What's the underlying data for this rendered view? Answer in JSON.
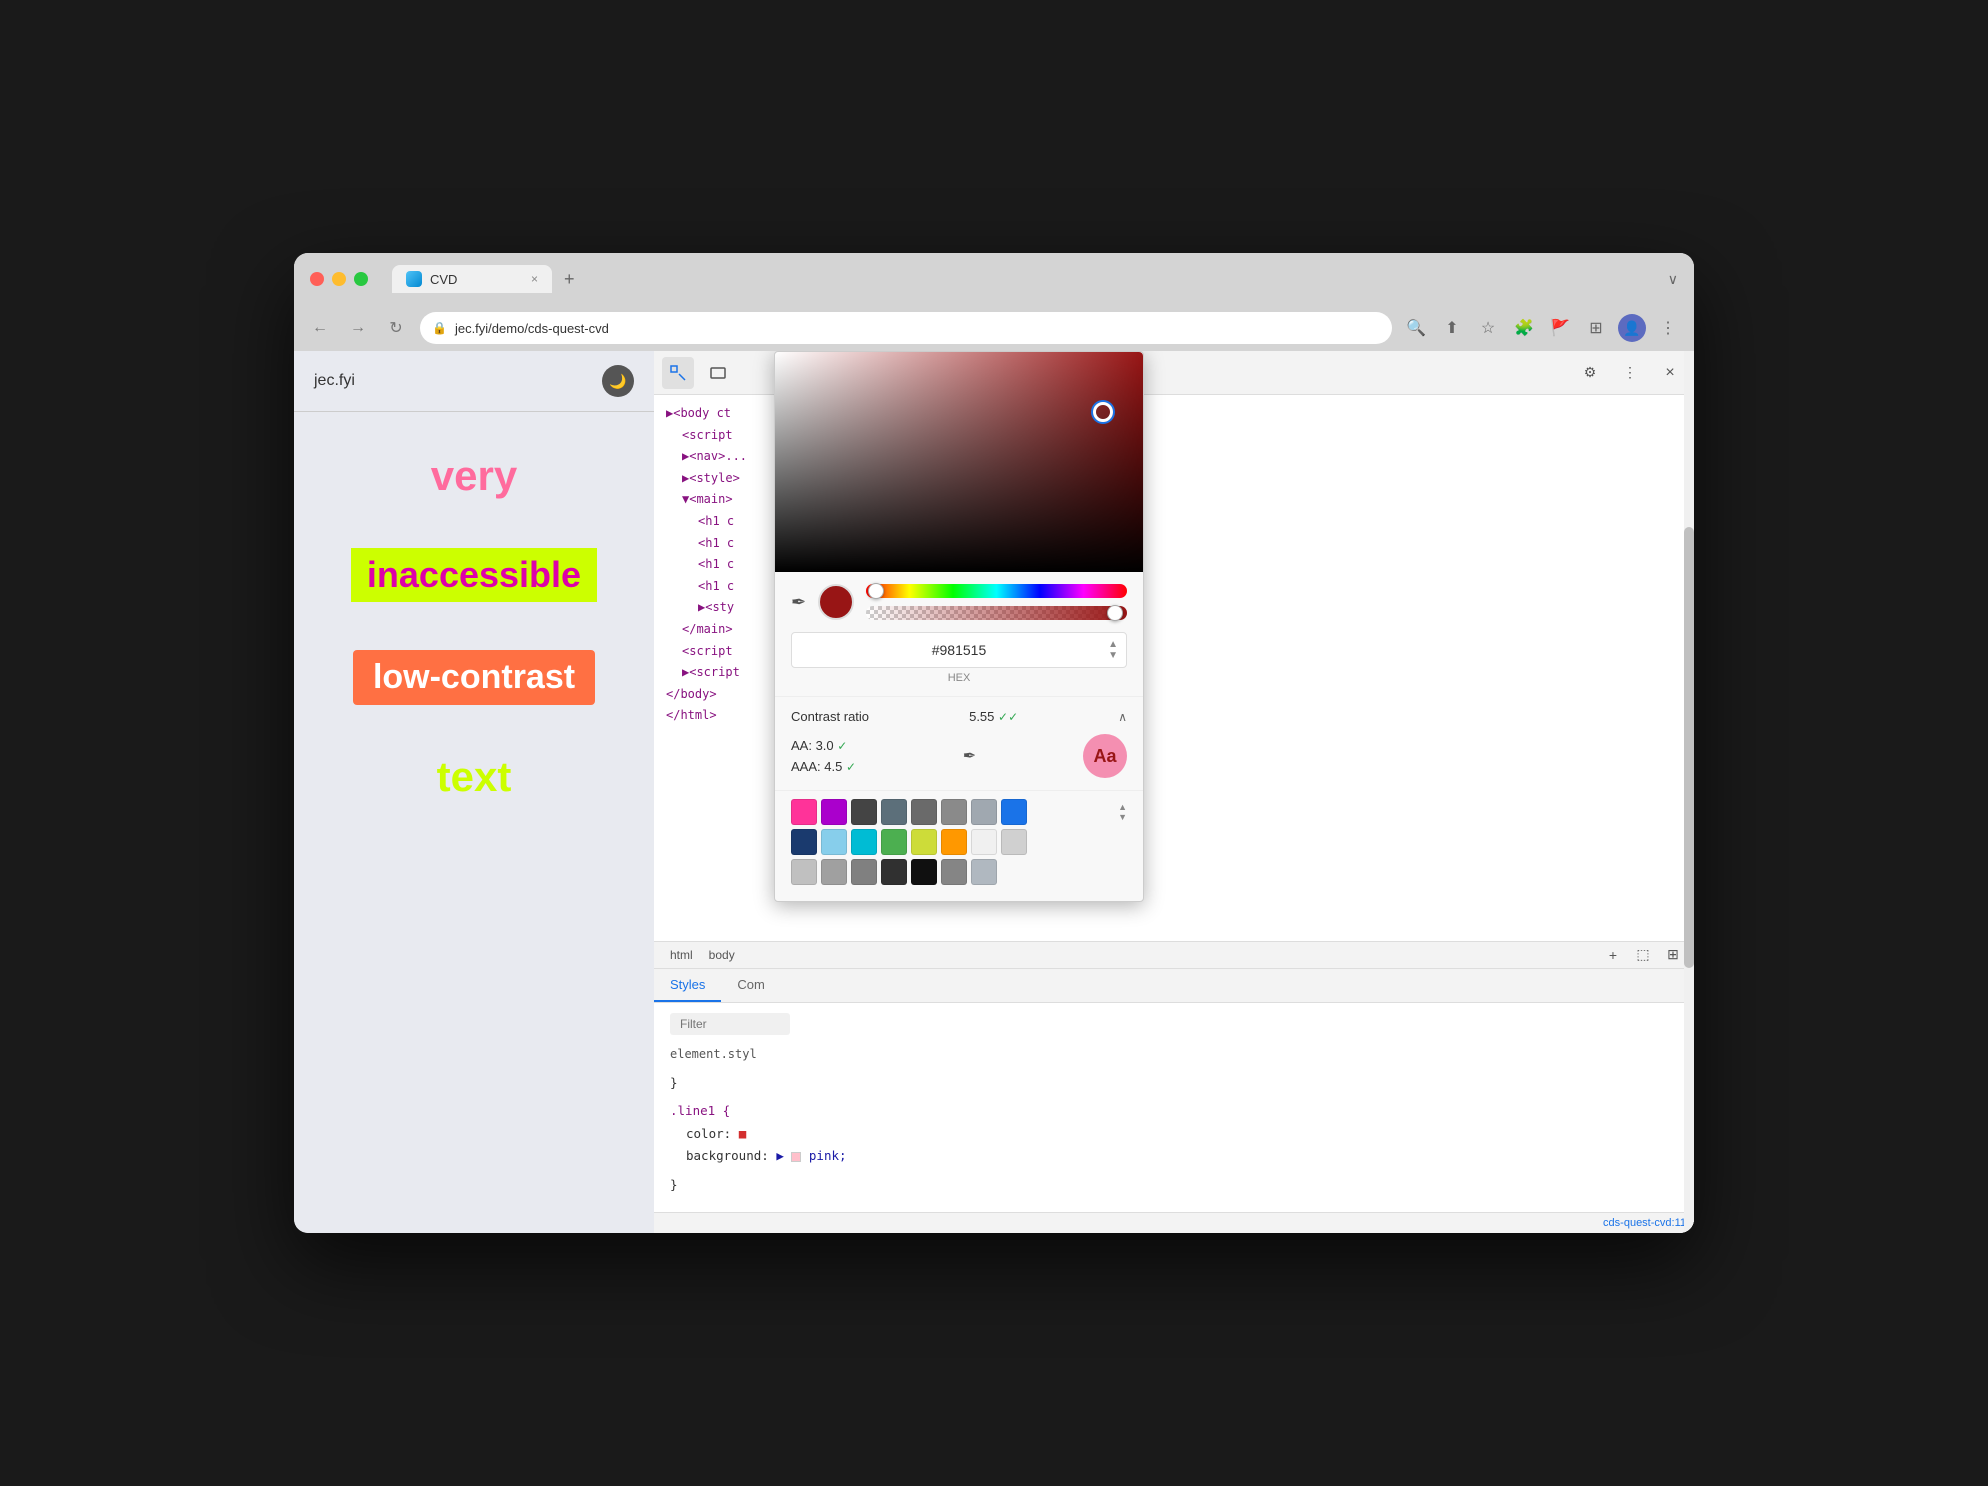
{
  "browser": {
    "traffic_lights": [
      "red",
      "yellow",
      "green"
    ],
    "tab": {
      "label": "CVD",
      "close": "×"
    },
    "new_tab": "+",
    "tab_menu": "∨",
    "address": "jec.fyi/demo/cds-quest-cvd",
    "lock_icon": "🔒",
    "nav_back": "←",
    "nav_forward": "→",
    "nav_refresh": "↻"
  },
  "page": {
    "title": "jec.fyi",
    "dark_mode_icon": "🌙",
    "demo_items": [
      {
        "text": "very",
        "style": "very"
      },
      {
        "text": "inaccessible",
        "style": "inaccessible"
      },
      {
        "text": "low-contrast",
        "style": "low-contrast"
      },
      {
        "text": "text",
        "style": "text"
      }
    ]
  },
  "devtools": {
    "inspect_icon": "⬚",
    "device_icon": "□",
    "settings_icon": "⚙",
    "more_icon": "⋮",
    "close_icon": "×",
    "dom_items": [
      {
        "indent": 0,
        "content": "▶<body ct"
      },
      {
        "indent": 1,
        "content": "<script"
      },
      {
        "indent": 1,
        "content": "▶<nav>..."
      },
      {
        "indent": 1,
        "content": "▶<style>"
      },
      {
        "indent": 1,
        "content": "▼<main>"
      },
      {
        "indent": 2,
        "content": "<h1 c"
      },
      {
        "indent": 2,
        "content": "<h1 c"
      },
      {
        "indent": 2,
        "content": "<h1 c"
      },
      {
        "indent": 2,
        "content": "<h1 c"
      },
      {
        "indent": 2,
        "content": "▶<sty"
      },
      {
        "indent": 1,
        "content": "</main>"
      },
      {
        "indent": 1,
        "content": "<script"
      },
      {
        "indent": 1,
        "content": "▶<script"
      },
      {
        "indent": 0,
        "content": "</body>"
      },
      {
        "indent": 0,
        "content": "</html>"
      }
    ],
    "element_tabs": [
      "Styles",
      "Com"
    ],
    "active_tab": "Styles",
    "filter_placeholder": "Filter",
    "css_rules": [
      {
        "selector": "element.styl",
        "props": []
      },
      {
        "brace_open": "}"
      },
      {
        "selector": ".line1 {",
        "props": [
          {
            "prop": "color:",
            "value": "■ red",
            "value_class": "css-value-red"
          },
          {
            "prop": "background:",
            "value": "▶ □ pink;",
            "value_class": "css-value-text"
          }
        ]
      },
      {
        "brace_close": "}"
      }
    ],
    "bottom_toolbar": {
      "add_btn": "+",
      "inspector_btn": "⬚",
      "expand_btn": "⊞"
    },
    "line_ref": "cds-quest-cvd:11",
    "scrollbar_visible": true
  },
  "color_picker": {
    "hex_value": "#981515",
    "hex_label": "HEX",
    "contrast_ratio": "5.55",
    "contrast_check": "✓✓",
    "aa_value": "3.0",
    "aa_check": "✓",
    "aaa_value": "4.5",
    "aaa_check": "✓",
    "collapse_icon": "∧",
    "eyedropper_icon": "✒",
    "swatches_row1": [
      {
        "color": "#ff3399"
      },
      {
        "color": "#aa00cc"
      },
      {
        "color": "#444444"
      },
      {
        "color": "#5c6f7a"
      },
      {
        "color": "#6a6a6a"
      },
      {
        "color": "#8a8a8a"
      },
      {
        "color": "#a0a8b0"
      },
      {
        "color": "#1a73e8"
      },
      {
        "color": "spinner"
      }
    ],
    "swatches_row2": [
      {
        "color": "#1a3a6e"
      },
      {
        "color": "#87ceeb"
      },
      {
        "color": "#00bcd4"
      },
      {
        "color": "#4caf50"
      },
      {
        "color": "#cddc39"
      },
      {
        "color": "#ff9800"
      },
      {
        "color": "#f0f0f0"
      },
      {
        "color": "#d0d0d0"
      }
    ],
    "swatches_row3": [
      {
        "color": "#c0c0c0"
      },
      {
        "color": "#a0a0a0"
      },
      {
        "color": "#808080"
      },
      {
        "color": "#303030"
      },
      {
        "color": "#101010"
      },
      {
        "color": "#858585"
      },
      {
        "color": "#b0b8c0"
      }
    ]
  }
}
